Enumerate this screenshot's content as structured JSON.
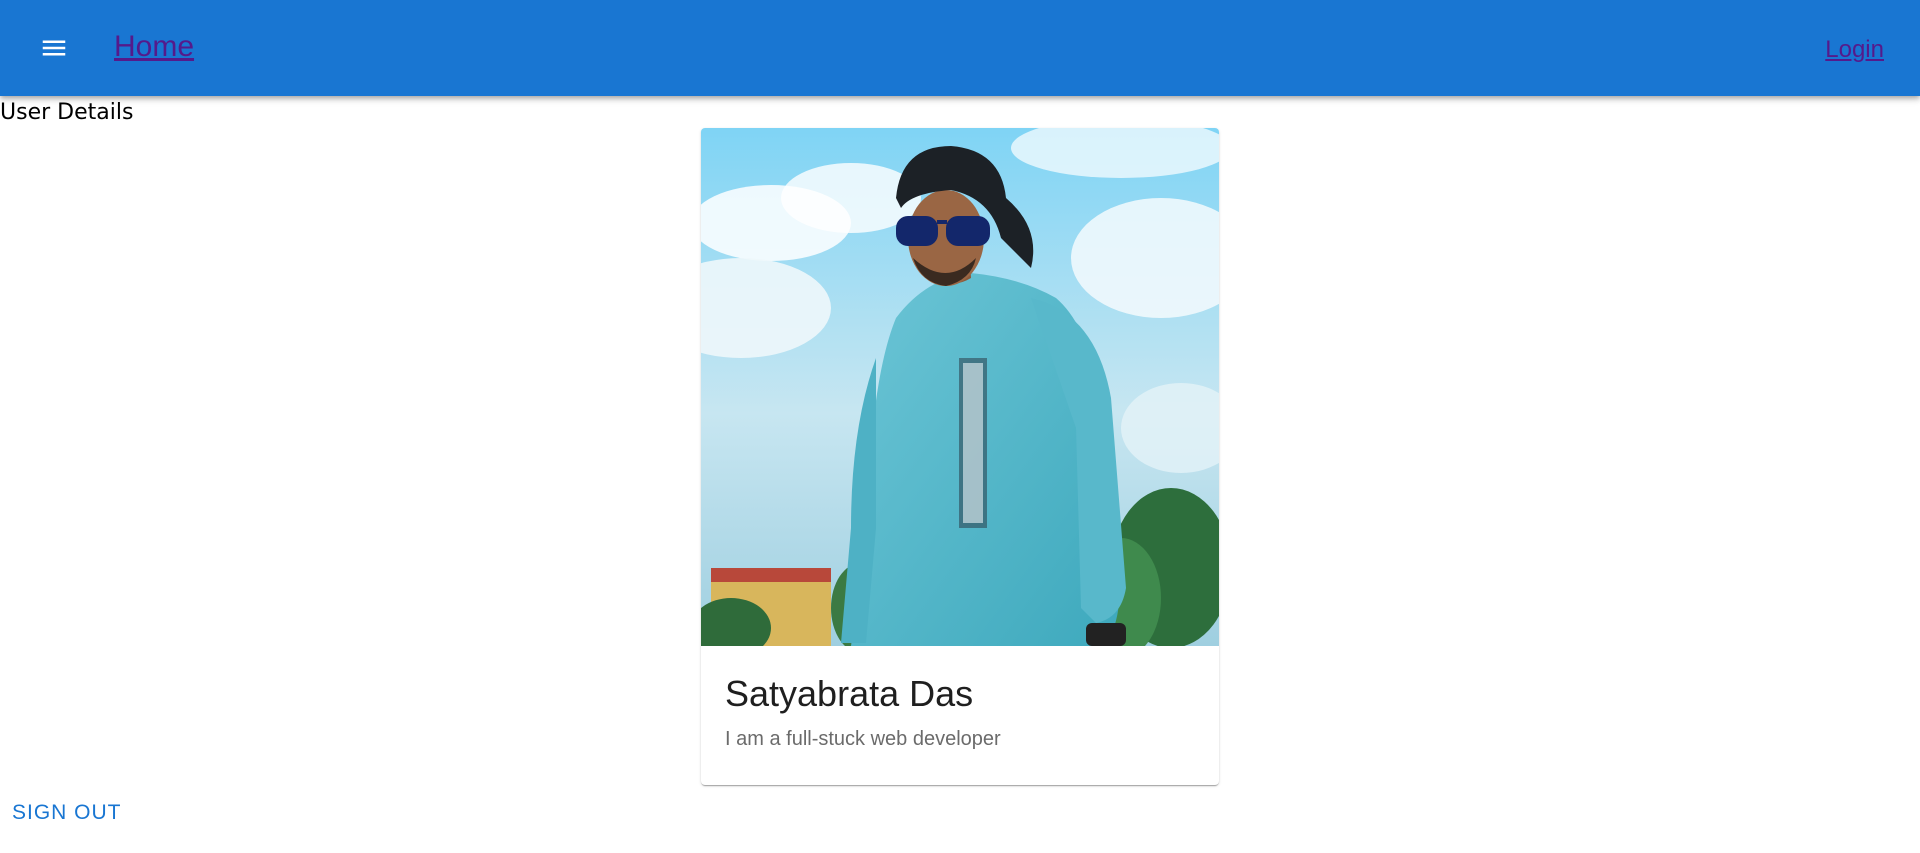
{
  "header": {
    "menu_icon": "menu-icon",
    "home_label": "Home",
    "login_label": "Login"
  },
  "page": {
    "heading": "User Details"
  },
  "profile_card": {
    "name": "Satyabrata Das",
    "bio": "I am a full-stuck web developer"
  },
  "actions": {
    "sign_out_label": "SIGN OUT"
  },
  "colors": {
    "appbar": "#1976d2",
    "link_visited": "#551a8b",
    "primary": "#1976d2"
  }
}
